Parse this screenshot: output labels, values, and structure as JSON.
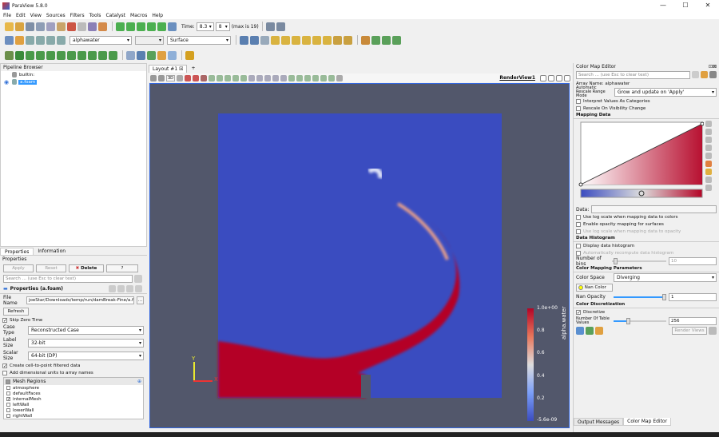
{
  "window": {
    "title": "ParaView 5.8.0",
    "min": "—",
    "max": "☐",
    "close": "✕"
  },
  "menu": [
    "File",
    "Edit",
    "View",
    "Sources",
    "Filters",
    "Tools",
    "Catalyst",
    "Macros",
    "Help"
  ],
  "toolbar": {
    "time_label": "Time:",
    "time_value": "8.3",
    "step_value": "8",
    "max_label": "(max is 19)",
    "array_combo": "alphawater",
    "repr_combo": "Surface",
    "small_combo": ""
  },
  "pipeline": {
    "title": "Pipeline Browser",
    "items": [
      "builtin:",
      "a.foam"
    ]
  },
  "properties": {
    "tabs": [
      "Properties",
      "Information"
    ],
    "title": "Properties",
    "apply": "Apply",
    "reset": "Reset",
    "delete": "Delete",
    "help": "?",
    "search_placeholder": "Search ... (use Esc to clear text)",
    "group_title": "Properties (a.foam)",
    "file_name_label": "File Name",
    "file_name_value": "joeStar/Downloads/temp/run/damBreak-Fine/a.foam",
    "refresh": "Refresh",
    "skip_zero": "Skip Zero Time",
    "case_type_label": "Case Type",
    "case_type_value": "Reconstructed Case",
    "label_size_label": "Label Size",
    "label_size_value": "32-bit",
    "scalar_size_label": "Scalar Size",
    "scalar_size_value": "64-bit (DP)",
    "create_cell": "Create cell-to-point filtered data",
    "add_dim": "Add dimensional units to array names",
    "mesh_regions": "Mesh Regions",
    "regions": [
      {
        "name": "atmosphere",
        "checked": false
      },
      {
        "name": "defaultFaces",
        "checked": false
      },
      {
        "name": "internalMesh",
        "checked": true
      },
      {
        "name": "leftWall",
        "checked": false
      },
      {
        "name": "lowerWall",
        "checked": false
      },
      {
        "name": "rightWall",
        "checked": false
      }
    ]
  },
  "view": {
    "tab": "Layout #1",
    "add_tab": "+",
    "label": "RenderView1",
    "btn_3d": "3D",
    "colorbar": {
      "title": "alpha.water",
      "ticks": [
        "1.0e+00",
        "0.8",
        "0.6",
        "0.4",
        "0.2",
        "-5.6e-09"
      ]
    },
    "axes": {
      "y": "Y",
      "x": "X"
    }
  },
  "cme": {
    "title": "Color Map Editor",
    "search_placeholder": "Search ... (use Esc to clear text)",
    "array_name": "Array Name: alphawater",
    "auto_label": "Automatic Rescale Range Mode",
    "auto_value": "Grow and update on 'Apply'",
    "interpret": "Interpret Values As Categories",
    "rescale_vis": "Rescale On Visibility Change",
    "mapping_data": "Mapping Data",
    "data_label": "Data:",
    "use_log": "Use log scale when mapping data to colors",
    "enable_opacity": "Enable opacity mapping for surfaces",
    "use_log_opacity": "Use log scale when mapping data to opacity",
    "data_histogram": "Data Histogram",
    "display_hist": "Display data histogram",
    "auto_hist": "Automatically recompute data histogram",
    "num_bins_label": "Number of bins",
    "num_bins_value": "10",
    "color_mapping_params": "Color Mapping Parameters",
    "color_space_label": "Color Space",
    "color_space_value": "Diverging",
    "nan_color": "Nan Color",
    "nan_opacity_label": "Nan Opacity",
    "nan_opacity_value": "1",
    "color_disc": "Color Discretization",
    "discretize": "Discretize",
    "table_values_label": "Number Of Table Values",
    "table_values_value": "256",
    "render_views": "Render Views",
    "tabs": [
      "Output Messages",
      "Color Map Editor"
    ]
  },
  "colors": {
    "accent": "#2f6fd6",
    "bg_view": "#52576b",
    "fluid_blue": "#3a4cc0",
    "fluid_red": "#b40426",
    "highlight": "#3399ff"
  }
}
